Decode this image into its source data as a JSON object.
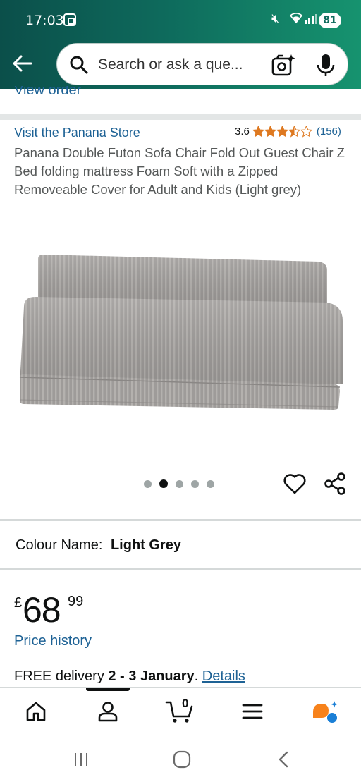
{
  "status_bar": {
    "time": "17:03",
    "battery": "81"
  },
  "search": {
    "placeholder": "Search or ask a que..."
  },
  "nav_previous": {
    "view_order_label": "View order"
  },
  "product": {
    "store_link": "Visit the Panana Store",
    "rating_value": "3.6",
    "rating_stars_fraction": 0.72,
    "rating_count": "(156)",
    "title": "Panana Double Futon Sofa Chair Fold Out Guest Chair Z Bed folding mattress Foam Soft with a Zipped Removeable Cover for Adult and Kids (Light grey)",
    "image_count": 5,
    "active_image_index": 1,
    "colour_label": "Colour Name:",
    "colour_value": "Light Grey",
    "price_currency": "£",
    "price_whole": "68",
    "price_fraction": "99",
    "price_history_label": "Price history",
    "delivery_prefix": "FREE delivery",
    "delivery_dates": "2 - 3 January",
    "delivery_suffix": ".",
    "delivery_details_link": "Details"
  },
  "bottom_nav": {
    "items": [
      "home-icon",
      "account-icon",
      "cart-icon",
      "menu-icon",
      "rufus-icon"
    ],
    "cart_count": "0",
    "active_index": 1
  },
  "colors": {
    "header_gradient_start": "#0b4f4a",
    "header_gradient_end": "#16936f",
    "link": "#1e6295",
    "star": "#de7921",
    "rufus_orange": "#f7821b",
    "rufus_blue": "#1a7fd6"
  }
}
